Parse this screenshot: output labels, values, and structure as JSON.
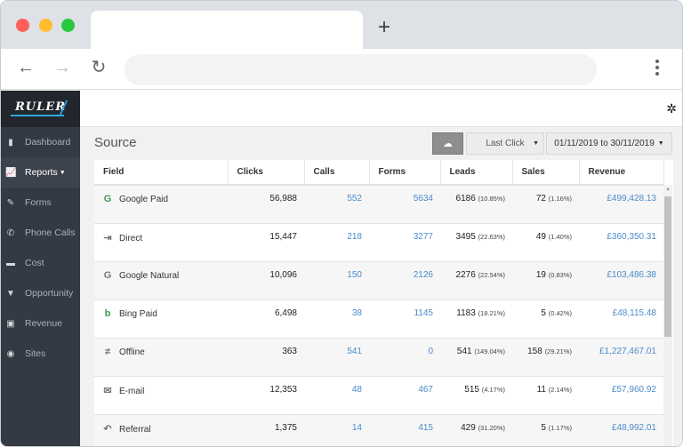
{
  "browser": {
    "new_tab_label": "+",
    "back_icon": "←",
    "forward_icon": "→",
    "reload_icon": "↻"
  },
  "sidebar": {
    "logo": "RULER",
    "items": [
      {
        "label": "Dashboard",
        "icon": "▮",
        "icon_name": "dashboard-icon",
        "active": false
      },
      {
        "label": "Reports",
        "icon": "📈",
        "icon_name": "chart-icon",
        "active": true,
        "caret": "▼"
      },
      {
        "label": "Forms",
        "icon": "✎",
        "icon_name": "pencil-icon",
        "active": false
      },
      {
        "label": "Phone Calls",
        "icon": "✆",
        "icon_name": "phone-icon",
        "active": false
      },
      {
        "label": "Cost",
        "icon": "▬",
        "icon_name": "credit-card-icon",
        "active": false
      },
      {
        "label": "Opportunity",
        "icon": "▼",
        "icon_name": "funnel-icon",
        "active": false
      },
      {
        "label": "Revenue",
        "icon": "▣",
        "icon_name": "money-icon",
        "active": false
      },
      {
        "label": "Sites",
        "icon": "◉",
        "icon_name": "globe-icon",
        "active": false
      }
    ]
  },
  "main": {
    "settings_icon": "✲",
    "title": "Source",
    "download_icon": "☁",
    "attribution_model": "Last Click",
    "attribution_caret": "▼",
    "date_range": "01/11/2019 to 30/11/2019",
    "date_caret": "▼"
  },
  "table": {
    "columns": [
      "Field",
      "Clicks",
      "Calls",
      "Forms",
      "Leads",
      "Sales",
      "Revenue"
    ],
    "rows": [
      {
        "field": "Google Paid",
        "icon": "G",
        "icon_name": "google-icon",
        "icon_color": "green",
        "clicks": "56,988",
        "calls": "552",
        "forms": "5634",
        "leads": "6186",
        "leads_pct": "(10.85%)",
        "sales": "72",
        "sales_pct": "(1.16%)",
        "revenue": "£499,428.13"
      },
      {
        "field": "Direct",
        "icon": "⇥",
        "icon_name": "sign-in-icon",
        "icon_color": "grey",
        "clicks": "15,447",
        "calls": "218",
        "forms": "3277",
        "leads": "3495",
        "leads_pct": "(22.63%)",
        "sales": "49",
        "sales_pct": "(1.40%)",
        "revenue": "£360,350.31"
      },
      {
        "field": "Google Natural",
        "icon": "G",
        "icon_name": "google-icon",
        "icon_color": "grey",
        "clicks": "10,096",
        "calls": "150",
        "forms": "2126",
        "leads": "2276",
        "leads_pct": "(22.54%)",
        "sales": "19",
        "sales_pct": "(0.83%)",
        "revenue": "£103,486.38"
      },
      {
        "field": "Bing Paid",
        "icon": "b",
        "icon_name": "bing-icon",
        "icon_color": "green",
        "clicks": "6,498",
        "calls": "38",
        "forms": "1145",
        "leads": "1183",
        "leads_pct": "(18.21%)",
        "sales": "5",
        "sales_pct": "(0.42%)",
        "revenue": "£48,115.48"
      },
      {
        "field": "Offline",
        "icon": "≠",
        "icon_name": "not-equal-icon",
        "icon_color": "grey",
        "clicks": "363",
        "calls": "541",
        "forms": "0",
        "leads": "541",
        "leads_pct": "(149.04%)",
        "sales": "158",
        "sales_pct": "(29.21%)",
        "revenue": "£1,227,467.01"
      },
      {
        "field": "E-mail",
        "icon": "✉",
        "icon_name": "envelope-icon",
        "icon_color": "grey",
        "clicks": "12,353",
        "calls": "48",
        "forms": "467",
        "leads": "515",
        "leads_pct": "(4.17%)",
        "sales": "11",
        "sales_pct": "(2.14%)",
        "revenue": "£57,960.92"
      },
      {
        "field": "Referral",
        "icon": "↶",
        "icon_name": "reply-icon",
        "icon_color": "grey",
        "clicks": "1,375",
        "calls": "14",
        "forms": "415",
        "leads": "429",
        "leads_pct": "(31.20%)",
        "sales": "5",
        "sales_pct": "(1.17%)",
        "revenue": "£48,992.01"
      }
    ]
  },
  "colors": {
    "sidebar_bg": "#343a44",
    "logo_bg": "#22272d",
    "accent_blue": "#2fa6dc",
    "link_blue": "#4a8bc9",
    "icon_green": "#3f9b55"
  }
}
